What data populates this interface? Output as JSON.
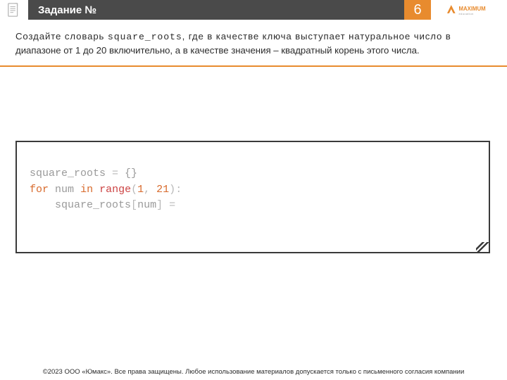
{
  "header": {
    "title": "Задание №",
    "number": "6"
  },
  "prompt": {
    "line1_a": "Создайте словарь ",
    "line1_code": "square_roots",
    "line1_b": ", где в качестве ключа выступает натуральное число в",
    "line2": "диапазоне от 1 до 20 включительно, а в качестве значения – квадратный корень этого числа."
  },
  "code": {
    "l1_id": "square_roots",
    "l1_eq": " = ",
    "l1_br": "{}",
    "l2_for": "for",
    "l2_sp1": " ",
    "l2_var": "num",
    "l2_sp2": " ",
    "l2_in": "in",
    "l2_sp3": " ",
    "l2_range": "range",
    "l2_open": "(",
    "l2_n1": "1",
    "l2_comma": ", ",
    "l2_n2": "21",
    "l2_close": ")",
    "l2_colon": ":",
    "l3_indent": "    ",
    "l3_id": "square_roots",
    "l3_open": "[",
    "l3_idx": "num",
    "l3_close": "]",
    "l3_eq": " = "
  },
  "footer": {
    "text": "©2023 ООО «Юмакс». Все права защищены. Любое использование материалов допускается только с письменного согласия компании"
  },
  "brand": {
    "name": "MAXIMUM"
  }
}
